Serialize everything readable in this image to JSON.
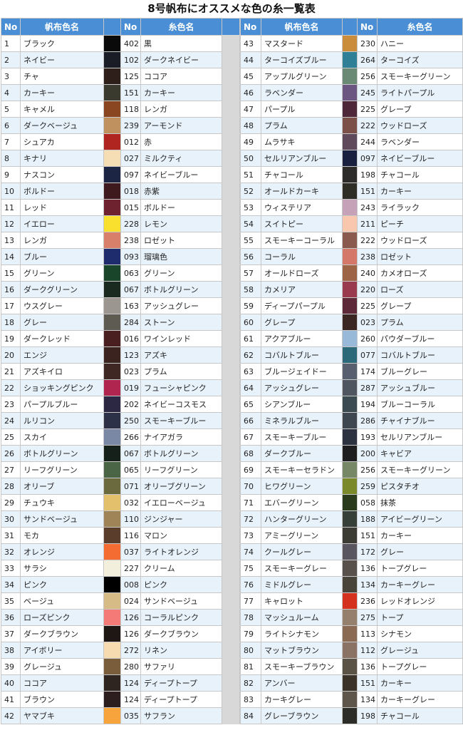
{
  "title": "8号帆布にオススメな色の糸一覧表",
  "headers": {
    "no": "No",
    "canvas": "帆布色名",
    "thread": "糸色名"
  },
  "left_rows": [
    {
      "no": "1",
      "name": "ブラック",
      "color": "#0a0a0a",
      "tno": "402",
      "tname": "黒"
    },
    {
      "no": "2",
      "name": "ネイビー",
      "color": "#1a1c26",
      "tno": "102",
      "tname": "ダークネイビー"
    },
    {
      "no": "3",
      "name": "チャ",
      "color": "#2e1f1a",
      "tno": "125",
      "tname": "ココア"
    },
    {
      "no": "4",
      "name": "カーキー",
      "color": "#3b3a2e",
      "tno": "151",
      "tname": "カーキー"
    },
    {
      "no": "5",
      "name": "キャメル",
      "color": "#8a4620",
      "tno": "118",
      "tname": "レンガ"
    },
    {
      "no": "6",
      "name": "ダークベージュ",
      "color": "#bf915e",
      "tno": "239",
      "tname": "アーモンド"
    },
    {
      "no": "7",
      "name": "シュアカ",
      "color": "#b0251f",
      "tno": "012",
      "tname": "赤"
    },
    {
      "no": "8",
      "name": "キナリ",
      "color": "#f5ddb5",
      "tno": "027",
      "tname": "ミルクティ"
    },
    {
      "no": "9",
      "name": "ナスコン",
      "color": "#1c2544",
      "tno": "097",
      "tname": "ネイビーブルー"
    },
    {
      "no": "10",
      "name": "ボルドー",
      "color": "#3e1a1e",
      "tno": "018",
      "tname": "赤紫"
    },
    {
      "no": "11",
      "name": "レッド",
      "color": "#6e2230",
      "tno": "015",
      "tname": "ボルドー"
    },
    {
      "no": "12",
      "name": "イエロー",
      "color": "#f9df2e",
      "tno": "228",
      "tname": "レモン"
    },
    {
      "no": "13",
      "name": "レンガ",
      "color": "#d9806b",
      "tno": "238",
      "tname": "ロゼット"
    },
    {
      "no": "14",
      "name": "ブルー",
      "color": "#1e2c6e",
      "tno": "093",
      "tname": "瑠璃色"
    },
    {
      "no": "15",
      "name": "グリーン",
      "color": "#19452a",
      "tno": "063",
      "tname": "グリーン"
    },
    {
      "no": "16",
      "name": "ダークグリーン",
      "color": "#1a2a20",
      "tno": "067",
      "tname": "ボトルグリーン"
    },
    {
      "no": "17",
      "name": "ウスグレー",
      "color": "#9b9790",
      "tno": "163",
      "tname": "アッシュグレー"
    },
    {
      "no": "18",
      "name": "グレー",
      "color": "#5e5c52",
      "tno": "284",
      "tname": "ストーン"
    },
    {
      "no": "19",
      "name": "ダークレッド",
      "color": "#4a1f1f",
      "tno": "016",
      "tname": "ワインレッド"
    },
    {
      "no": "20",
      "name": "エンジ",
      "color": "#3b2420",
      "tno": "123",
      "tname": "アズキ"
    },
    {
      "no": "21",
      "name": "アズキイロ",
      "color": "#3f2824",
      "tno": "023",
      "tname": "プラム"
    },
    {
      "no": "22",
      "name": "ショッキングピンク",
      "color": "#b02450",
      "tno": "019",
      "tname": "フューシャピンク"
    },
    {
      "no": "23",
      "name": "パープルブルー",
      "color": "#2c2844",
      "tno": "202",
      "tname": "ネイビーコスモス"
    },
    {
      "no": "24",
      "name": "ルリコン",
      "color": "#2d3148",
      "tno": "250",
      "tname": "スモーキーブルー"
    },
    {
      "no": "25",
      "name": "スカイ",
      "color": "#7a88a6",
      "tno": "266",
      "tname": "ナイアガラ"
    },
    {
      "no": "26",
      "name": "ボトルグリーン",
      "color": "#15201a",
      "tno": "067",
      "tname": "ボトルグリーン"
    },
    {
      "no": "27",
      "name": "リーフグリーン",
      "color": "#4a6446",
      "tno": "065",
      "tname": "リーフグリーン"
    },
    {
      "no": "28",
      "name": "オリーブ",
      "color": "#6a6a3e",
      "tno": "071",
      "tname": "オリーブグリーン"
    },
    {
      "no": "29",
      "name": "チュウキ",
      "color": "#e3c06c",
      "tno": "032",
      "tname": "イエローベージュ"
    },
    {
      "no": "30",
      "name": "サンドベージュ",
      "color": "#9e8456",
      "tno": "110",
      "tname": "ジンジャー"
    },
    {
      "no": "31",
      "name": "モカ",
      "color": "#5a3d2a",
      "tno": "116",
      "tname": "マロン"
    },
    {
      "no": "32",
      "name": "オレンジ",
      "color": "#f46c32",
      "tno": "037",
      "tname": "ライトオレンジ"
    },
    {
      "no": "33",
      "name": "サラシ",
      "color": "#f2f0dc",
      "tno": "227",
      "tname": "クリーム"
    },
    {
      "no": "34",
      "name": "ピンク",
      "color": "#000000",
      "tno": "008",
      "tname": "ピンク"
    },
    {
      "no": "35",
      "name": "ベージュ",
      "color": "#d6bb86",
      "tno": "024",
      "tname": "サンドベージュ"
    },
    {
      "no": "36",
      "name": "ローズピンク",
      "color": "#f47a78",
      "tno": "126",
      "tname": "コーラルピンク"
    },
    {
      "no": "37",
      "name": "ダークブラウン",
      "color": "#1e1714",
      "tno": "126",
      "tname": "ダークブラウン"
    },
    {
      "no": "38",
      "name": "アイボリー",
      "color": "#f7dbb0",
      "tno": "272",
      "tname": "リネン"
    },
    {
      "no": "39",
      "name": "グレージュ",
      "color": "#7a5e3c",
      "tno": "280",
      "tname": "サファリ"
    },
    {
      "no": "40",
      "name": "ココア",
      "color": "#2e2420",
      "tno": "124",
      "tname": "ディープトープ"
    },
    {
      "no": "41",
      "name": "ブラウン",
      "color": "#2c1e1e",
      "tno": "124",
      "tname": "ディープトープ"
    },
    {
      "no": "42",
      "name": "ヤマブキ",
      "color": "#f8a43c",
      "tno": "035",
      "tname": "サフラン"
    }
  ],
  "right_rows": [
    {
      "no": "43",
      "name": "マスタード",
      "color": "#c98d3c",
      "tno": "230",
      "tname": "ハニー"
    },
    {
      "no": "44",
      "name": "ターコイズブルー",
      "color": "#2f7f96",
      "tno": "264",
      "tname": "ターコイズ"
    },
    {
      "no": "45",
      "name": "アップルグリーン",
      "color": "#6b8a76",
      "tno": "256",
      "tname": "スモーキーグリーン"
    },
    {
      "no": "46",
      "name": "ラベンダー",
      "color": "#6a5680",
      "tno": "245",
      "tname": "ライトパープル"
    },
    {
      "no": "47",
      "name": "パープル",
      "color": "#4e2838",
      "tno": "225",
      "tname": "グレープ"
    },
    {
      "no": "48",
      "name": "プラム",
      "color": "#7a5048",
      "tno": "222",
      "tname": "ウッドローズ"
    },
    {
      "no": "49",
      "name": "ムラサキ",
      "color": "#5e4a5a",
      "tno": "244",
      "tname": "ラベンダー"
    },
    {
      "no": "50",
      "name": "セルリアンブルー",
      "color": "#1a2140",
      "tno": "097",
      "tname": "ネイビーブルー"
    },
    {
      "no": "51",
      "name": "チャコール",
      "color": "#2e2c2a",
      "tno": "198",
      "tname": "チャコール"
    },
    {
      "no": "52",
      "name": "オールドカーキ",
      "color": "#2e2e26",
      "tno": "151",
      "tname": "カーキー"
    },
    {
      "no": "53",
      "name": "ウィステリア",
      "color": "#c6a2b8",
      "tno": "243",
      "tname": "ライラック"
    },
    {
      "no": "54",
      "name": "スイトピー",
      "color": "#f9c7ae",
      "tno": "211",
      "tname": "ピーチ"
    },
    {
      "no": "55",
      "name": "スモーキーコーラル",
      "color": "#8a5a4e",
      "tno": "222",
      "tname": "ウッドローズ"
    },
    {
      "no": "56",
      "name": "コーラル",
      "color": "#d4786a",
      "tno": "238",
      "tname": "ロゼット"
    },
    {
      "no": "57",
      "name": "オールドローズ",
      "color": "#9e6446",
      "tno": "240",
      "tname": "カメオローズ"
    },
    {
      "no": "58",
      "name": "カメリア",
      "color": "#9a3a4e",
      "tno": "220",
      "tname": "ローズ"
    },
    {
      "no": "59",
      "name": "ディープパープル",
      "color": "#5e2a3a",
      "tno": "225",
      "tname": "グレープ"
    },
    {
      "no": "60",
      "name": "グレープ",
      "color": "#3a2622",
      "tno": "023",
      "tname": "プラム"
    },
    {
      "no": "61",
      "name": "アクアブルー",
      "color": "#98b9d8",
      "tno": "260",
      "tname": "パウダーブルー"
    },
    {
      "no": "62",
      "name": "コバルトブルー",
      "color": "#2c6a7a",
      "tno": "077",
      "tname": "コバルトブルー"
    },
    {
      "no": "63",
      "name": "ブルージェイドー",
      "color": "#586070",
      "tno": "174",
      "tname": "ブルーグレー"
    },
    {
      "no": "64",
      "name": "アッシュグレー",
      "color": "#505660",
      "tno": "287",
      "tname": "アッシュブルー"
    },
    {
      "no": "65",
      "name": "シアンブルー",
      "color": "#3c4a52",
      "tno": "194",
      "tname": "ブルーコーラル"
    },
    {
      "no": "66",
      "name": "ミネラルブルー",
      "color": "#3e4650",
      "tno": "286",
      "tname": "チャイナブルー"
    },
    {
      "no": "67",
      "name": "スモーキーブルー",
      "color": "#2c3240",
      "tno": "193",
      "tname": "セルリアンブルー"
    },
    {
      "no": "68",
      "name": "ダークブルー",
      "color": "#1e1e20",
      "tno": "200",
      "tname": "キャビア"
    },
    {
      "no": "69",
      "name": "スモーキーセラドン",
      "color": "#768866",
      "tno": "256",
      "tname": "スモーキーグリーン"
    },
    {
      "no": "70",
      "name": "ヒワグリーン",
      "color": "#7a8a2a",
      "tno": "259",
      "tname": "ピスタチオ"
    },
    {
      "no": "71",
      "name": "エバーグリーン",
      "color": "#2a3a1c",
      "tno": "058",
      "tname": "抹茶"
    },
    {
      "no": "72",
      "name": "ハンターグリーン",
      "color": "#364038",
      "tno": "188",
      "tname": "アイビーグリーン"
    },
    {
      "no": "73",
      "name": "アミーグリーン",
      "color": "#3c3c34",
      "tno": "151",
      "tname": "カーキー"
    },
    {
      "no": "74",
      "name": "クールグレー",
      "color": "#5a5660",
      "tno": "172",
      "tname": "グレー"
    },
    {
      "no": "75",
      "name": "スモーキーグレー",
      "color": "#58504a",
      "tno": "136",
      "tname": "トープグレー"
    },
    {
      "no": "76",
      "name": "ミドルグレー",
      "color": "#48443a",
      "tno": "134",
      "tname": "カーキーグレー"
    },
    {
      "no": "77",
      "name": "キャロット",
      "color": "#d4321e",
      "tno": "236",
      "tname": "レッドオレンジ"
    },
    {
      "no": "78",
      "name": "マッシュルーム",
      "color": "#94806c",
      "tno": "275",
      "tname": "トープ"
    },
    {
      "no": "79",
      "name": "ライトシナモン",
      "color": "#8a6a52",
      "tno": "113",
      "tname": "シナモン"
    },
    {
      "no": "80",
      "name": "マットブラウン",
      "color": "#8a7264",
      "tno": "112",
      "tname": "グレージュ"
    },
    {
      "no": "81",
      "name": "スモーキーブラウン",
      "color": "#5a5244",
      "tno": "136",
      "tname": "トープグレー"
    },
    {
      "no": "82",
      "name": "アンバー",
      "color": "#3a3228",
      "tno": "151",
      "tname": "カーキー"
    },
    {
      "no": "83",
      "name": "カーキグレー",
      "color": "#5e564a",
      "tno": "134",
      "tname": "カーキーグレー"
    },
    {
      "no": "84",
      "name": "グレーブラウン",
      "color": "#2c2c28",
      "tno": "198",
      "tname": "チャコール"
    }
  ]
}
